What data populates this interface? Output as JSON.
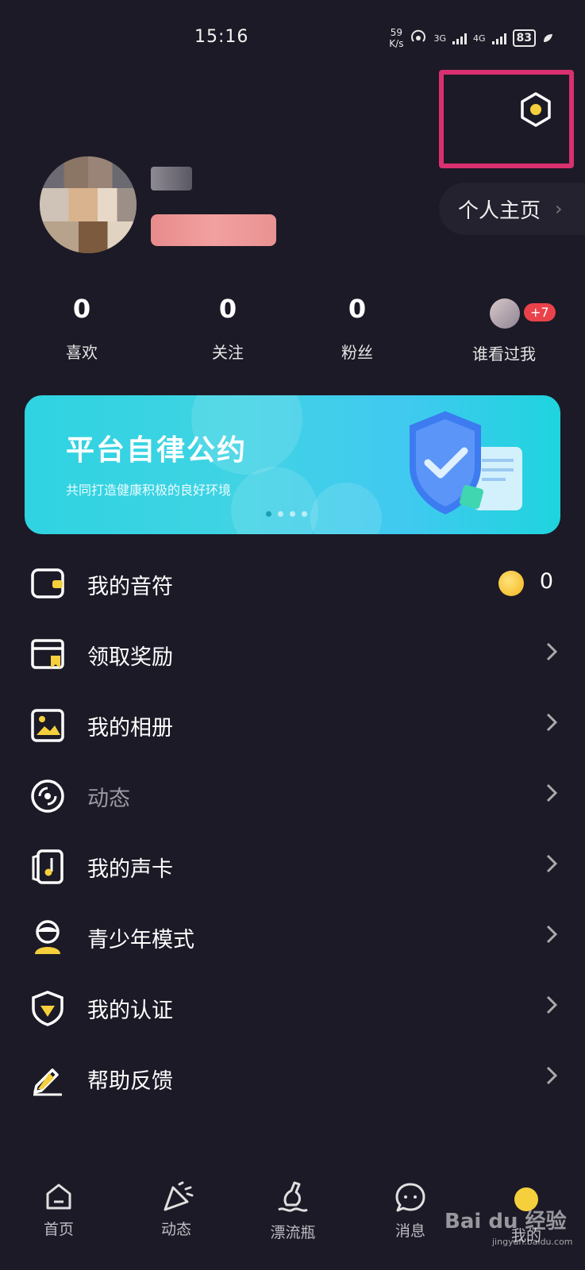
{
  "status_bar": {
    "time": "15:16",
    "speed_value": "59",
    "speed_unit": "K/s",
    "network_1": "3G",
    "network_2": "4G",
    "battery": "83"
  },
  "profile": {
    "homepage_label": "个人主页",
    "stats": [
      {
        "value": "0",
        "label": "喜欢"
      },
      {
        "value": "0",
        "label": "关注"
      },
      {
        "value": "0",
        "label": "粉丝"
      }
    ],
    "visitors_label": "谁看过我",
    "visitors_badge": "+7"
  },
  "banner": {
    "title": "平台自律公约",
    "subtitle": "共同打造健康积极的良好环境"
  },
  "menu": {
    "notes": {
      "label": "我的音符",
      "value": "0"
    },
    "rewards": {
      "label": "领取奖励"
    },
    "album": {
      "label": "我的相册"
    },
    "moments": {
      "label": "动态"
    },
    "voice_card": {
      "label": "我的声卡"
    },
    "youth_mode": {
      "label": "青少年模式"
    },
    "verification": {
      "label": "我的认证"
    },
    "help": {
      "label": "帮助反馈"
    }
  },
  "bottom_nav": {
    "home": "首页",
    "moments": "动态",
    "bottle": "漂流瓶",
    "messages": "消息",
    "me": "我的"
  },
  "watermark": {
    "brand": "Bai du 经验",
    "url": "jingyan.baidu.com"
  },
  "colors": {
    "background": "#1c1a26",
    "accent_yellow": "#f5cf3c",
    "highlight": "#d9306f",
    "banner": "#2fd3e1",
    "badge": "#e9424b"
  }
}
